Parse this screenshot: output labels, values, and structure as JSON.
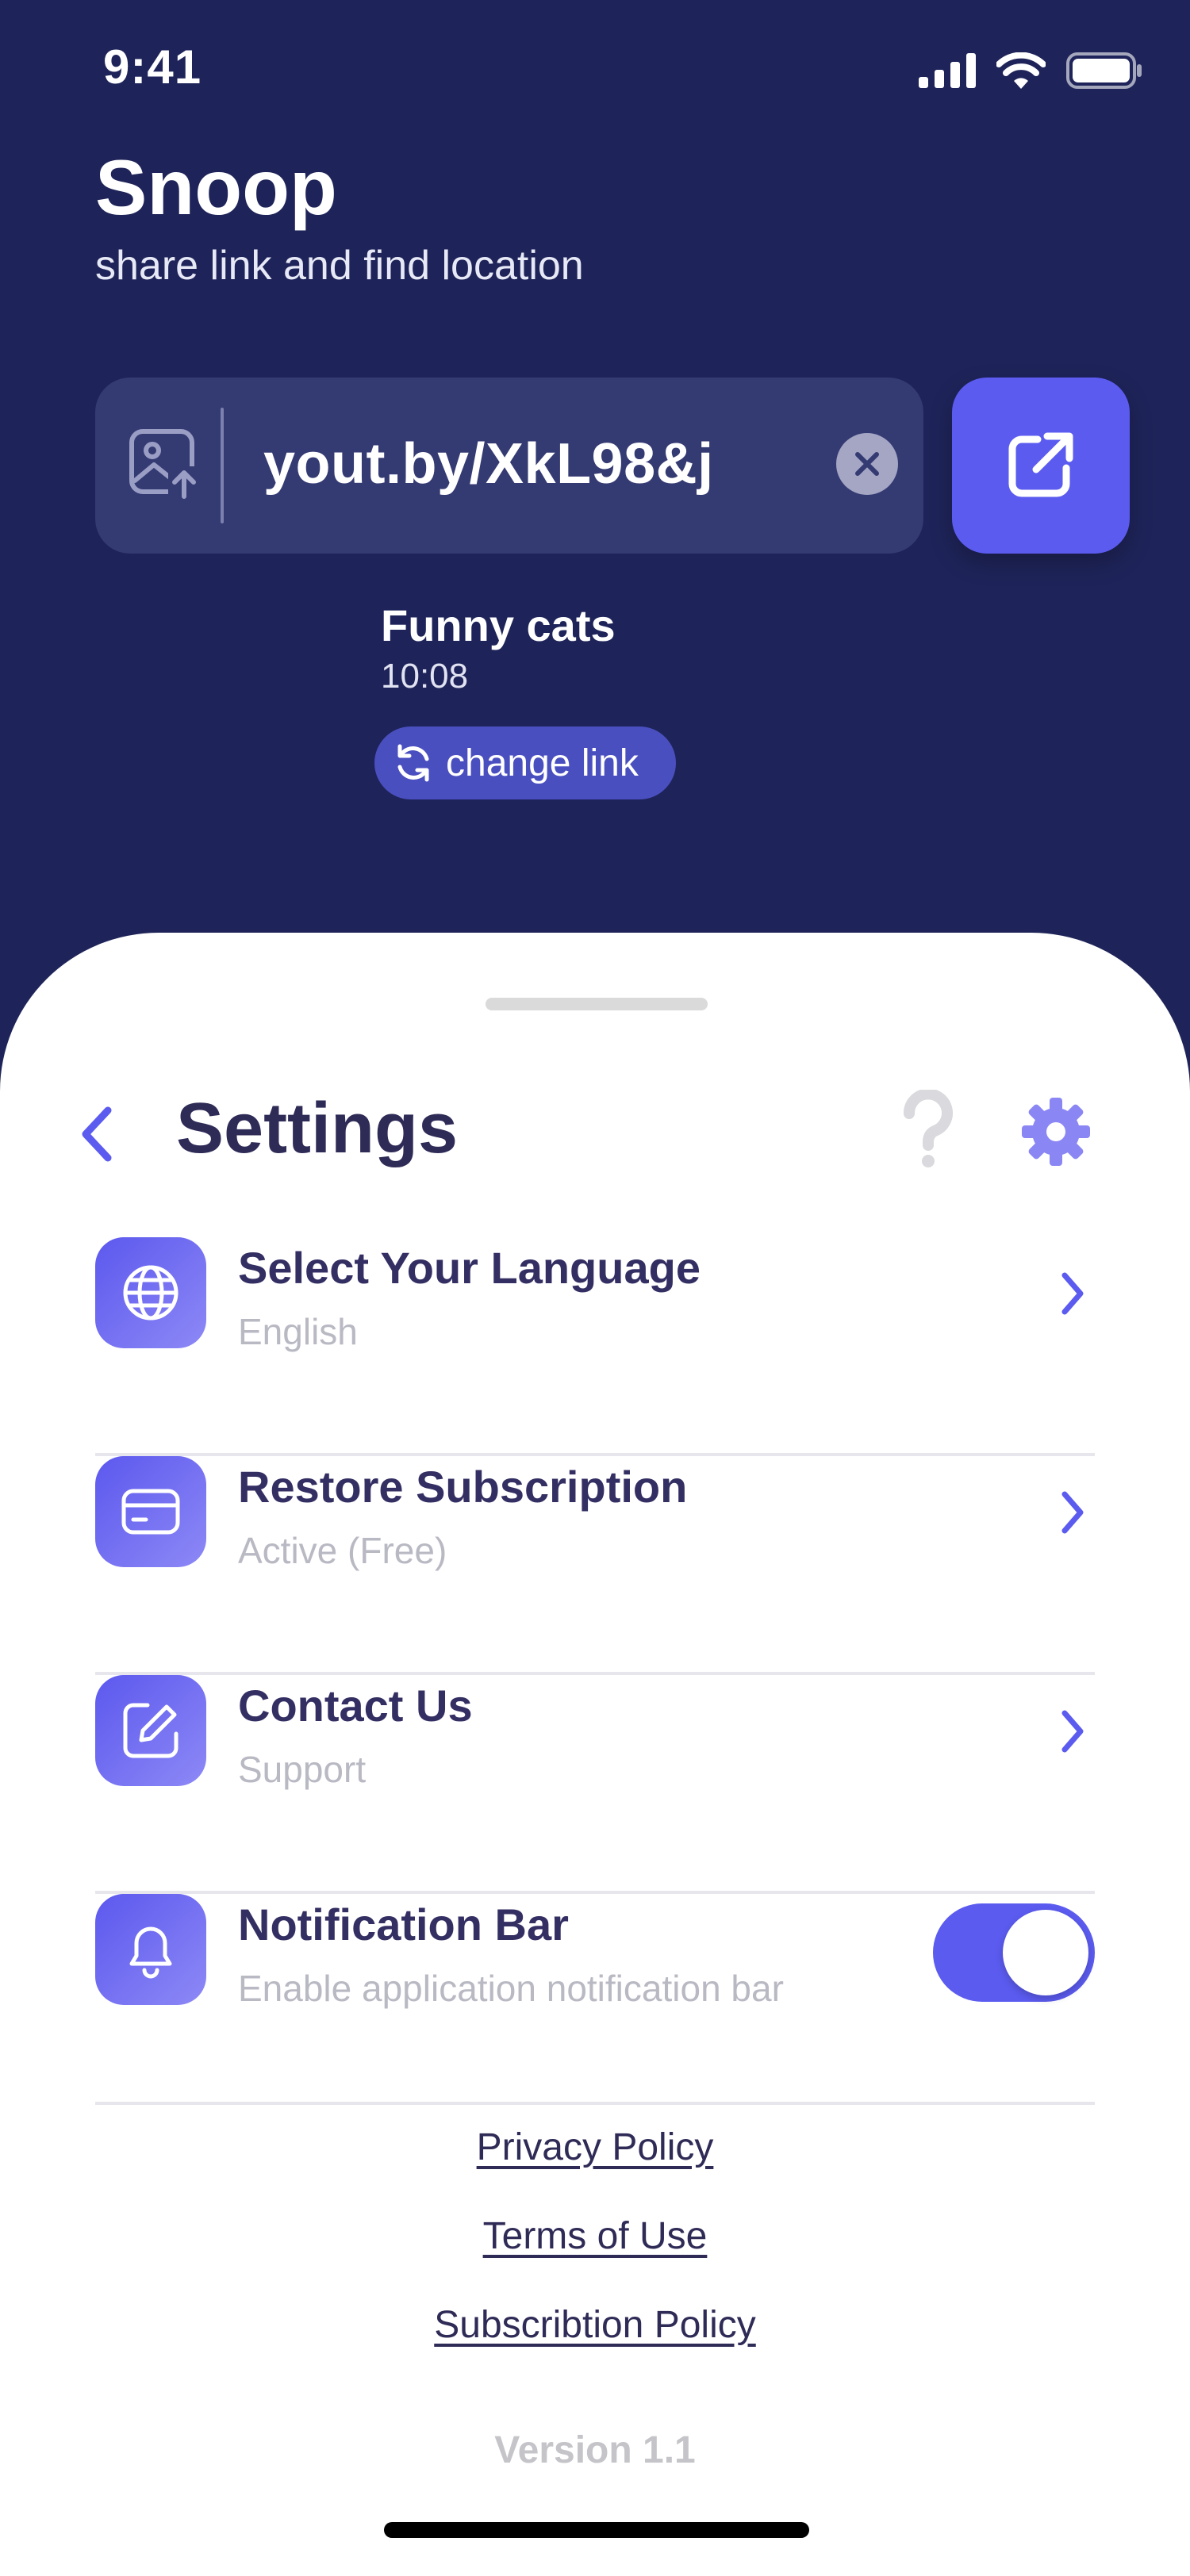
{
  "status_bar": {
    "time": "9:41"
  },
  "header": {
    "app_name": "Snoop",
    "tagline": "share link and find location"
  },
  "link_input": {
    "value": "yout.by/XkL98&j",
    "icons": {
      "leading": "image-upload-icon",
      "clear": "clear-circle-icon",
      "action": "external-link-icon"
    }
  },
  "video": {
    "title": "Funny cats",
    "time": "10:08",
    "change_label": "change link"
  },
  "settings": {
    "title": "Settings",
    "items": [
      {
        "title": "Select Your Language",
        "subtitle": "English",
        "icon": "globe-icon"
      },
      {
        "title": "Restore Subscription",
        "subtitle": "Active (Free)",
        "icon": "credit-card-icon"
      },
      {
        "title": "Contact Us",
        "subtitle": "Support",
        "icon": "edit-note-icon"
      },
      {
        "title": "Notification Bar",
        "subtitle": "Enable application notification bar",
        "icon": "bell-icon",
        "toggle_on": true
      }
    ]
  },
  "footer": {
    "links": [
      "Privacy Policy",
      "Terms of Use",
      "Subscribtion Policy"
    ],
    "version": "Version 1.1"
  },
  "colors": {
    "background": "#1E2459",
    "accent": "#5B5BF0",
    "title_text": "#2F2B57",
    "muted_text": "#B9B9C4"
  }
}
